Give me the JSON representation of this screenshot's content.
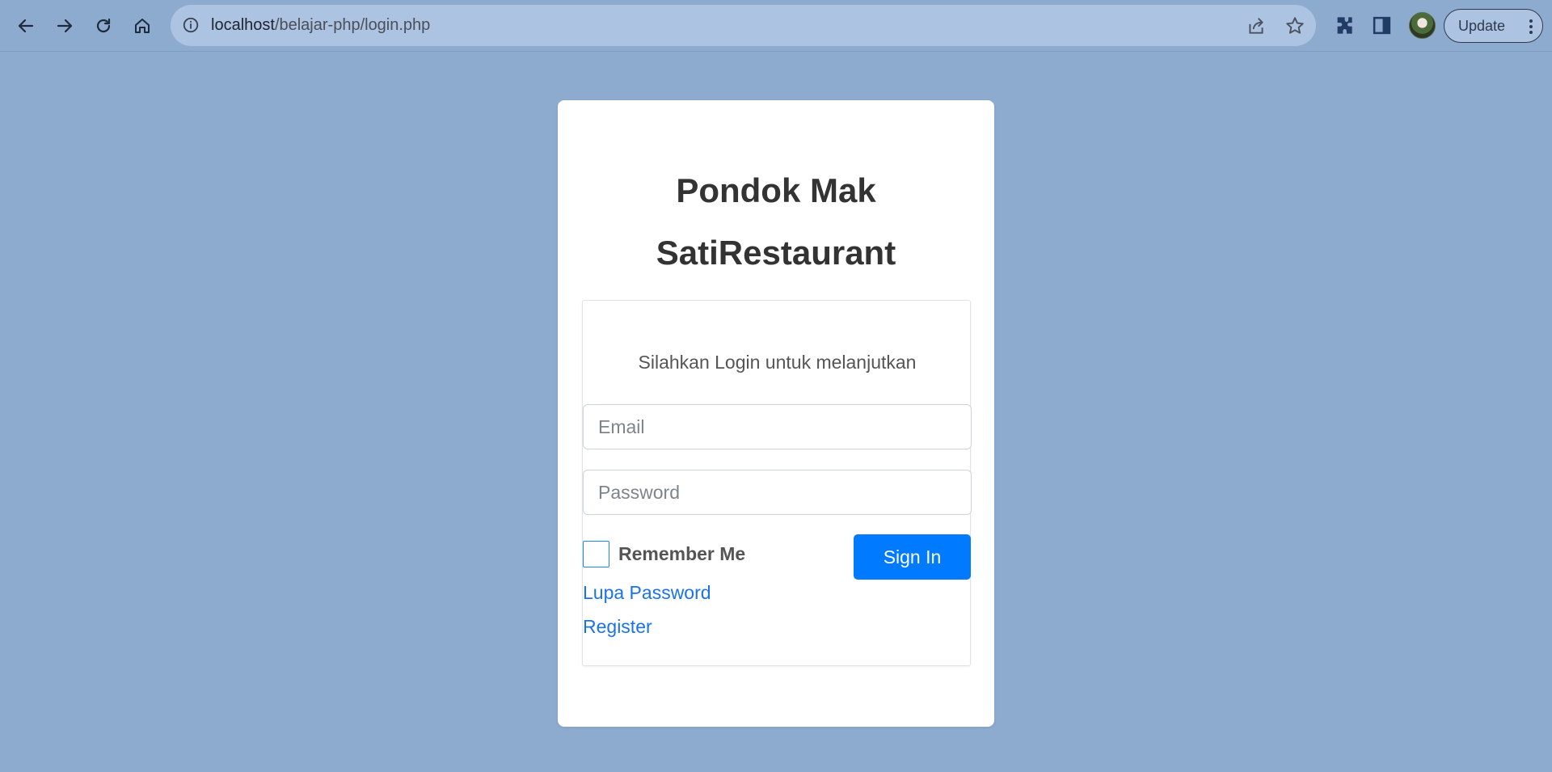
{
  "browser": {
    "url_host": "localhost",
    "url_path": "/belajar-php/login.php",
    "update_label": "Update",
    "icons": [
      "back-icon",
      "forward-icon",
      "reload-icon",
      "home-icon",
      "info-icon",
      "share-icon",
      "star-icon",
      "extensions-icon",
      "side-panel-icon",
      "avatar",
      "more-icon"
    ]
  },
  "page": {
    "title_line1": "Pondok Mak",
    "title_line2": "SatiRestaurant",
    "subtitle": "Silahkan Login untuk melanjutkan",
    "email_placeholder": "Email",
    "password_placeholder": "Password",
    "remember_label": "Remember Me",
    "signin_label": "Sign In",
    "forgot_link": "Lupa Password",
    "register_link": "Register"
  },
  "colors": {
    "background": "#8cabcf",
    "omnibox": "#adc3e2",
    "primary_button": "#007bff",
    "link": "#1a73e8"
  }
}
